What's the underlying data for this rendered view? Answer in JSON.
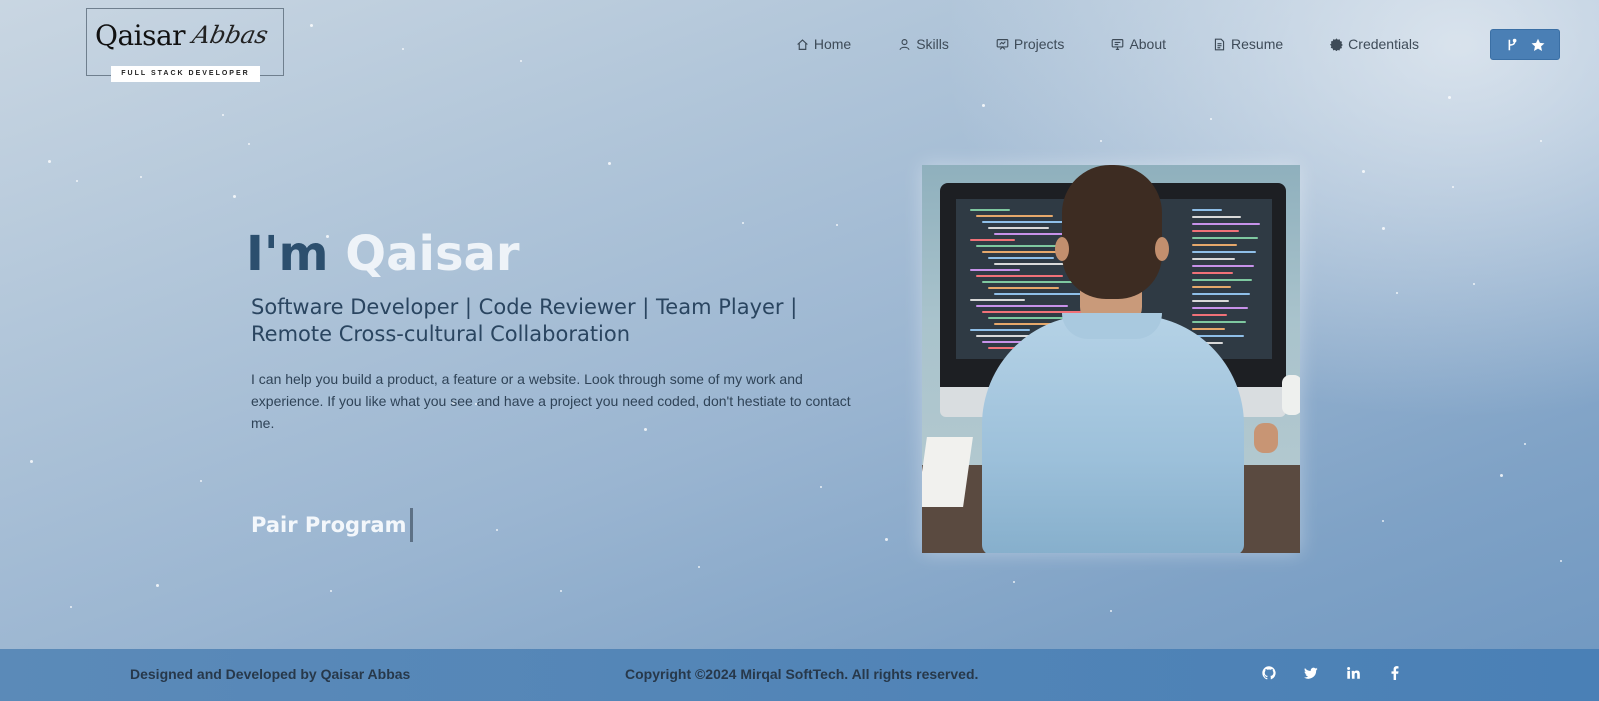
{
  "logo": {
    "name": "Qaisar",
    "script": "Abbas",
    "tagline": "FULL STACK DEVELOPER"
  },
  "nav": {
    "items": [
      {
        "label": "Home",
        "icon": "home-icon"
      },
      {
        "label": "Skills",
        "icon": "user-icon"
      },
      {
        "label": "Projects",
        "icon": "presentation-icon"
      },
      {
        "label": "About",
        "icon": "monitor-chat-icon"
      },
      {
        "label": "Resume",
        "icon": "document-icon"
      },
      {
        "label": "Credentials",
        "icon": "badge-icon"
      }
    ],
    "github_button": {
      "icons": [
        "git-fork-icon",
        "star-icon"
      ]
    }
  },
  "hero": {
    "greeting": "I'm",
    "name": "Qaisar",
    "roles": "Software Developer | Code Reviewer | Team Player | Remote Cross-cultural Collaboration",
    "description": "I can help you build a product, a feature or a website. Look through some of my work and experience. If you like what you see and have a project you need coded, don't hestiate to contact me.",
    "typed_text": "Pair Program"
  },
  "footer": {
    "left": "Designed and Developed by Qaisar Abbas",
    "center": "Copyright ©2024 Mirqal SoftTech. All rights reserved.",
    "socials": [
      "github-icon",
      "twitter-icon",
      "linkedin-icon",
      "facebook-icon"
    ]
  },
  "colors": {
    "accent": "#4a7fb5",
    "hero_name": "#eef3f8",
    "hero_greeting": "#2c4f6e",
    "footer_bg": "#4a80b6"
  }
}
